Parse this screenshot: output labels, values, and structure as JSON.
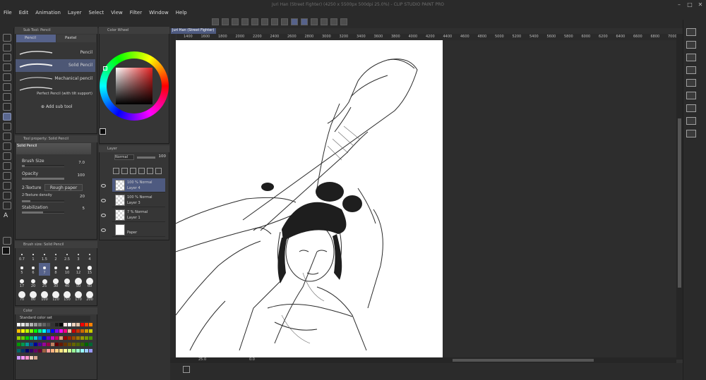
{
  "window": {
    "title": "Juri Han (Street Fighter) (4250 x 5500px 500dpi 25.0%) - CLIP STUDIO PAINT PRO"
  },
  "menu": [
    "File",
    "Edit",
    "Animation",
    "Layer",
    "Select",
    "View",
    "Filter",
    "Window",
    "Help"
  ],
  "document_tab": "Juri Han (Street Fighter)",
  "sub_tool": {
    "panel_title": "Sub Tool: Pencil",
    "tabs": [
      "Pencil",
      "Pastel"
    ],
    "items": [
      "Pencil",
      "Solid Pencil",
      "Mechanical pencil",
      "Perfect Pencil (with tilt support)"
    ],
    "selected": "Solid Pencil",
    "add_label": "Add sub tool"
  },
  "color_wheel": {
    "panel_title": "Color Wheel",
    "hue_color": "#e22020"
  },
  "tool_property": {
    "panel_title": "Tool property: Solid Pencil",
    "preset_name": "Solid Pencil",
    "brush_size_label": "Brush Size",
    "brush_size_value": "7.0",
    "opacity_label": "Opacity",
    "opacity_value": "100",
    "texture_label": "2-Texture",
    "texture_value": "Rough paper",
    "texture_density_label": "2-Texture density",
    "texture_density_value": "20",
    "stabilization_label": "Stabilization",
    "stabilization_value": "5",
    "brush_size_fraction": 0.07,
    "opacity_fraction": 1.0,
    "density_fraction": 0.2,
    "stabilization_fraction": 0.5
  },
  "layers": {
    "panel_title": "Layer",
    "blend_mode": "Normal",
    "opacity": "100",
    "rows": [
      {
        "info": "100 % Normal",
        "name": "Layer 4",
        "selected": true
      },
      {
        "info": "100 % Normal",
        "name": "Layer 3",
        "selected": false
      },
      {
        "info": "7 % Normal",
        "name": "Layer 1",
        "selected": false
      },
      {
        "info": "",
        "name": "Paper",
        "selected": false
      }
    ]
  },
  "brush_size": {
    "panel_title": "Brush size: Solid Pencil",
    "sizes": [
      "0.7",
      "1",
      "1.5",
      "2",
      "2.5",
      "3",
      "4",
      "5",
      "6",
      "7",
      "8",
      "10",
      "12",
      "15",
      "17",
      "20",
      "25",
      "30",
      "40",
      "50",
      "60",
      "70",
      "80",
      "100",
      "120",
      "150",
      "170",
      "200"
    ],
    "selected": "7"
  },
  "color_set": {
    "panel_title": "Color",
    "set_name": "Standard color set"
  },
  "rulers": [
    "1400",
    "1600",
    "1800",
    "2000",
    "2200",
    "2400",
    "2600",
    "2800",
    "3000",
    "3200",
    "3400",
    "3600",
    "3800",
    "4000",
    "4200",
    "4400",
    "4600",
    "4800",
    "5000",
    "5200",
    "5400",
    "5600",
    "5800",
    "6000",
    "6200",
    "6400",
    "6600",
    "6800",
    "7000"
  ],
  "status": {
    "zoom": "25.0",
    "angle": "0.0"
  },
  "colors": {
    "accent": "#56628a",
    "selected_layer": "#4e5a80",
    "panel": "#363636",
    "canvas_bg": "#2d2d2d"
  }
}
